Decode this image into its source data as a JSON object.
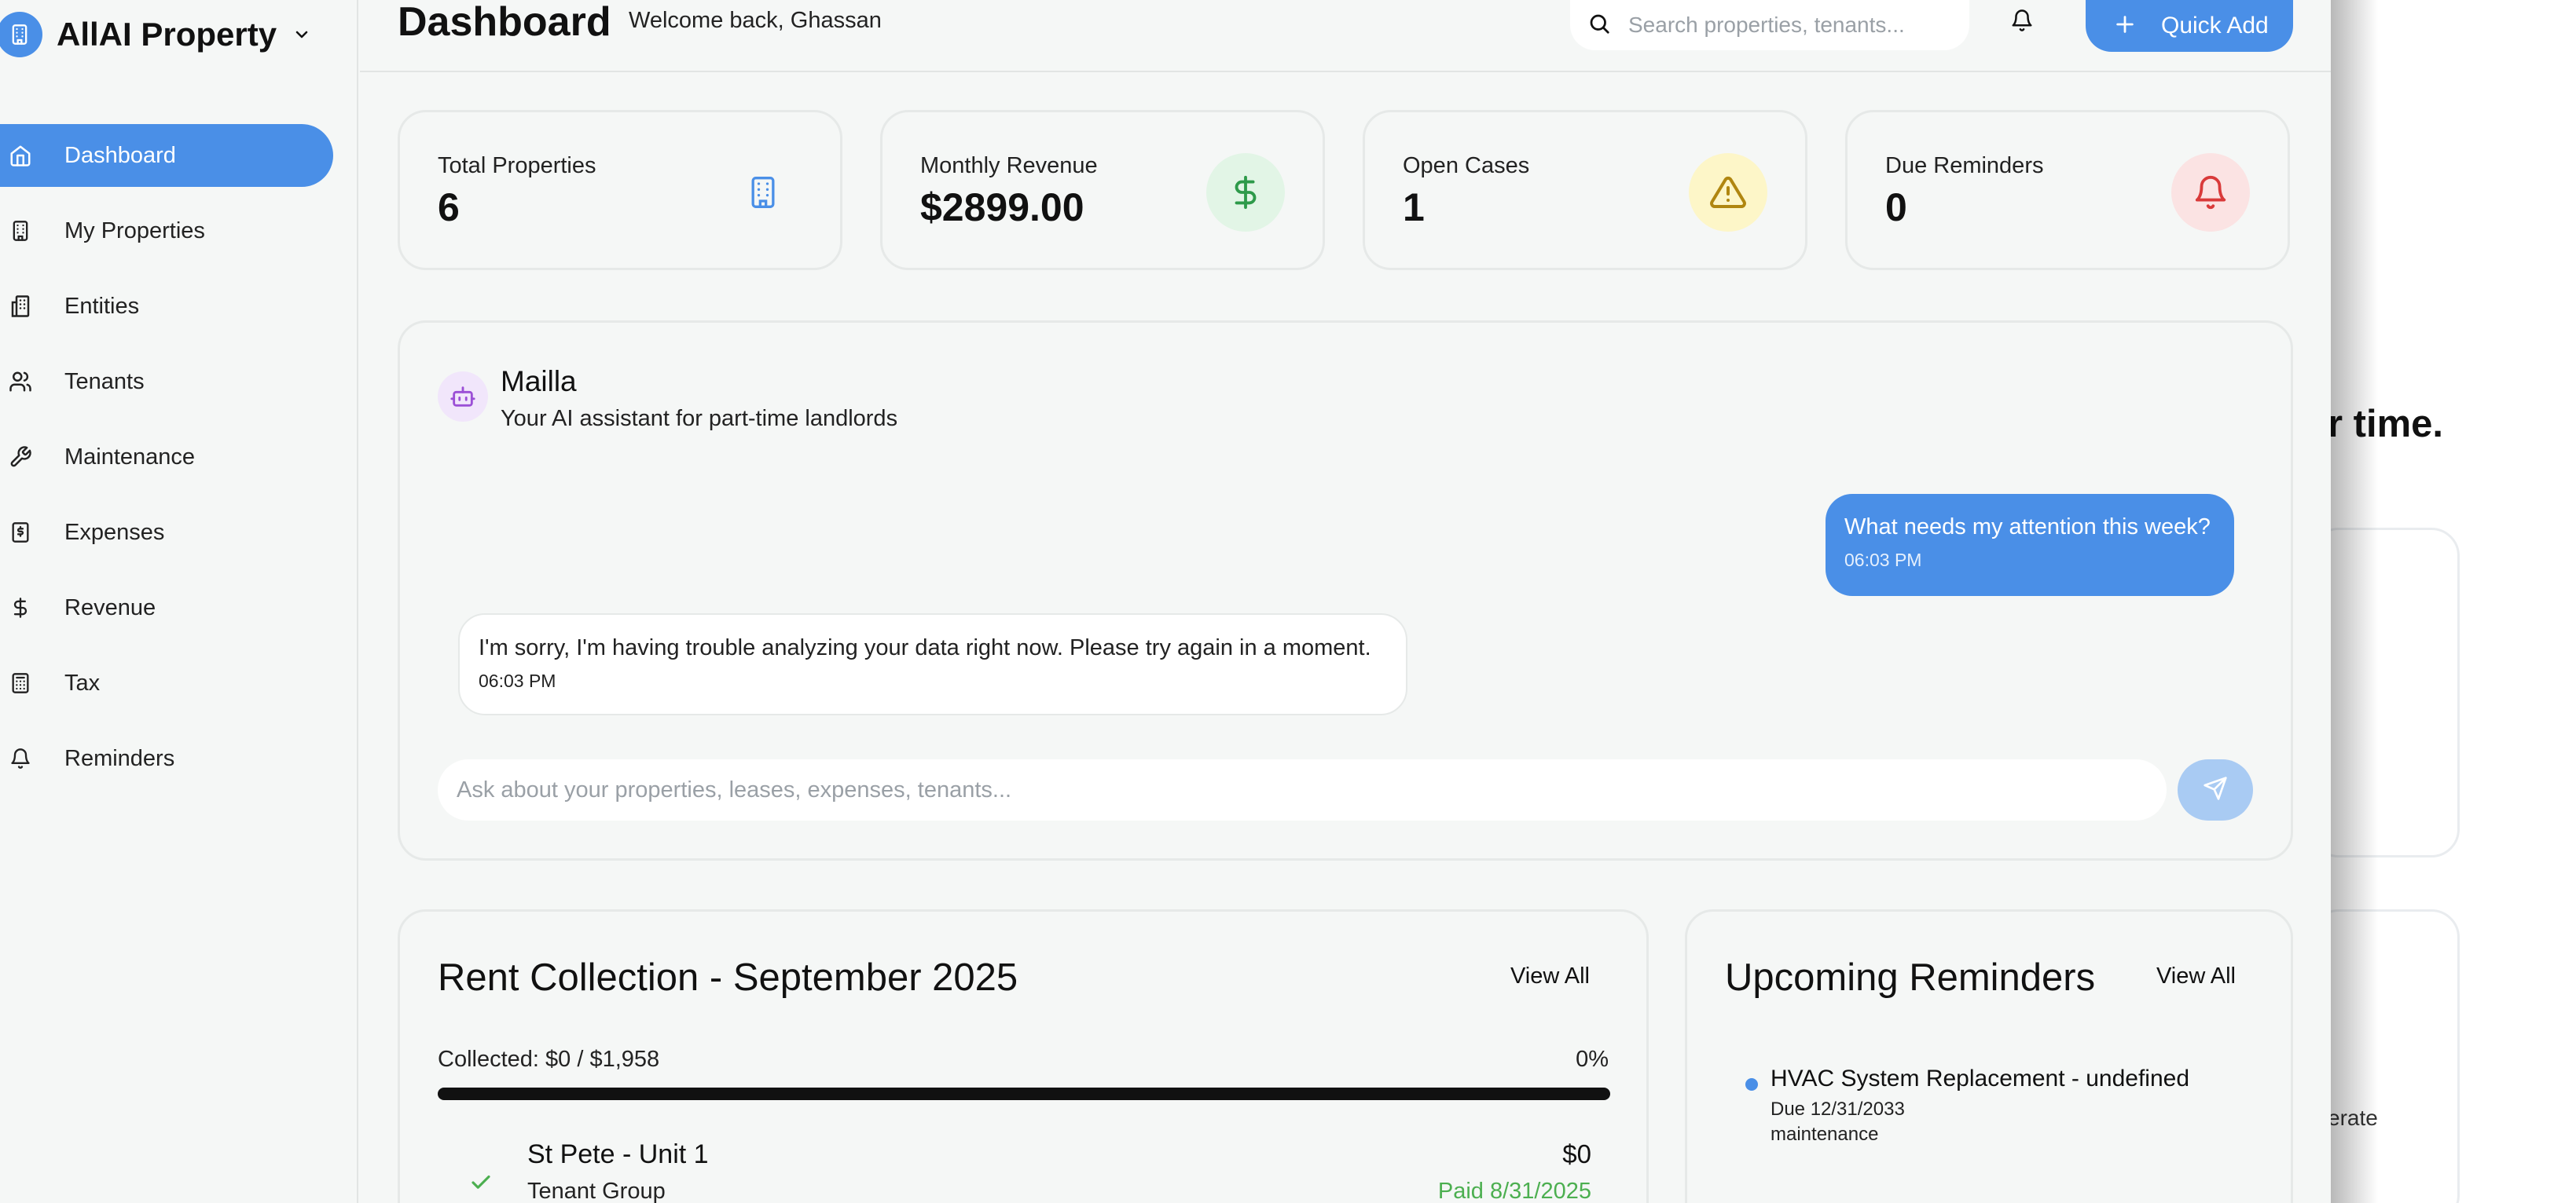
{
  "app": {
    "brand": "AllAI Property",
    "accent_color": "#4a8fe7"
  },
  "sidebar": {
    "items": [
      {
        "label": "Dashboard",
        "icon": "home-icon",
        "active": true
      },
      {
        "label": "My Properties",
        "icon": "building-icon"
      },
      {
        "label": "Entities",
        "icon": "buildings-icon"
      },
      {
        "label": "Tenants",
        "icon": "users-icon"
      },
      {
        "label": "Maintenance",
        "icon": "wrench-icon"
      },
      {
        "label": "Expenses",
        "icon": "receipt-icon"
      },
      {
        "label": "Revenue",
        "icon": "dollar-icon"
      },
      {
        "label": "Tax",
        "icon": "calculator-icon"
      },
      {
        "label": "Reminders",
        "icon": "bell-icon"
      }
    ]
  },
  "header": {
    "title": "Dashboard",
    "welcome": "Welcome back, Ghassan",
    "search_placeholder": "Search properties, tenants...",
    "quick_add_label": "Quick Add"
  },
  "stats": [
    {
      "label": "Total Properties",
      "value": "6",
      "icon": "building-icon",
      "icon_bg": "#f5f7f6",
      "icon_color": "#4a8fe7"
    },
    {
      "label": "Monthly Revenue",
      "value": "$2899.00",
      "icon": "dollar-icon",
      "icon_bg": "#e2f5e6",
      "icon_color": "#2e9a4a"
    },
    {
      "label": "Open Cases",
      "value": "1",
      "icon": "warning-icon",
      "icon_bg": "#fdf6c8",
      "icon_color": "#c49a12"
    },
    {
      "label": "Due Reminders",
      "value": "0",
      "icon": "bell-icon",
      "icon_bg": "#fbe3e3",
      "icon_color": "#d93a3a"
    }
  ],
  "assistant": {
    "name": "Mailla",
    "subtitle": "Your AI assistant for part-time landlords",
    "messages": [
      {
        "from": "user",
        "text": "What needs my attention this week?",
        "time": "06:03 PM"
      },
      {
        "from": "bot",
        "text": "I'm sorry, I'm having trouble analyzing your data right now. Please try again in a moment.",
        "time": "06:03 PM"
      }
    ],
    "input_placeholder": "Ask about your properties, leases, expenses, tenants..."
  },
  "rent_collection": {
    "title": "Rent Collection - September 2025",
    "view_all": "View All",
    "collected_text": "Collected: $0 / $1,958",
    "percent_text": "0%",
    "percent_value": 0,
    "rows": [
      {
        "name": "St Pete - Unit 1",
        "tenant": "Tenant Group",
        "amount": "$0",
        "status": "Paid 8/31/2025"
      }
    ]
  },
  "reminders": {
    "title": "Upcoming Reminders",
    "view_all": "View All",
    "items": [
      {
        "title": "HVAC System Replacement - undefined",
        "due": "Due 12/31/2033",
        "category": "maintenance"
      }
    ]
  },
  "background_page": {
    "heading_fragment": "r time.",
    "text_fragment": "erate"
  }
}
